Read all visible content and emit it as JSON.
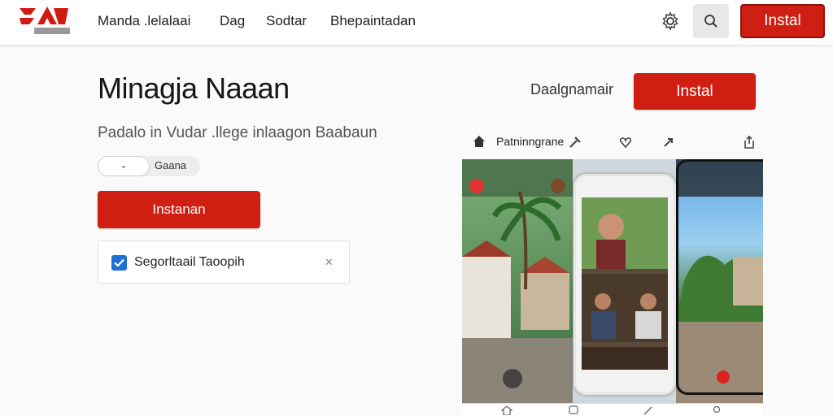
{
  "header": {
    "nav": [
      "Manda .lelalaai",
      "Dag",
      "Sodtar",
      "Bhepaintadan"
    ],
    "install_label": "Instal"
  },
  "hero": {
    "title": "Minagja Naaan",
    "subtitle": "Padalo in Vudar .llege inlaagon Baabaun",
    "rating_value": "-",
    "rating_label": "Gaana",
    "install_label": "Instanan",
    "checkbox_label": "Segorltaail Taoopih"
  },
  "side": {
    "developer": "Daalgnamair",
    "install_label": "Instal",
    "preview_label": "Patninngrane"
  },
  "colors": {
    "accent": "#cf1f12",
    "checkbox": "#1e6fd6"
  },
  "icons": [
    "logo",
    "settings-icon",
    "search-icon",
    "home-icon",
    "share-icon"
  ]
}
